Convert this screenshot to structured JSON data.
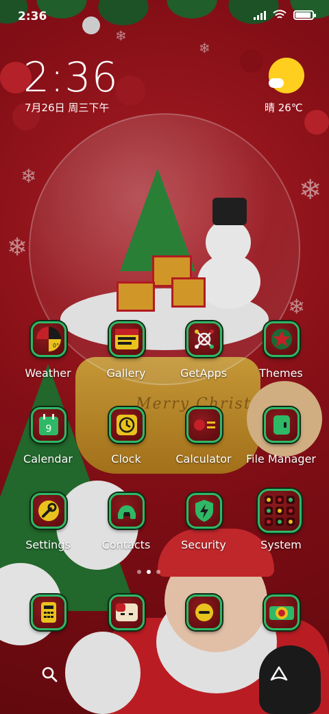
{
  "status_bar": {
    "time": "2:36",
    "icons": [
      "signal-icon",
      "wifi-icon",
      "battery-icon"
    ],
    "battery_level": 0.9
  },
  "clock_widget": {
    "time": "2:36",
    "date": "7月26日 周三下午"
  },
  "weather_widget": {
    "icon": "sunny-partly-cloudy-icon",
    "text": "晴 26℃"
  },
  "apps": {
    "row1": [
      {
        "label": "Weather",
        "icon": "weather-icon"
      },
      {
        "label": "Gallery",
        "icon": "gallery-icon"
      },
      {
        "label": "GetApps",
        "icon": "getapps-icon"
      },
      {
        "label": "Themes",
        "icon": "themes-icon"
      }
    ],
    "row2": [
      {
        "label": "Calendar",
        "icon": "calendar-icon",
        "badge": "9"
      },
      {
        "label": "Clock",
        "icon": "clock-icon"
      },
      {
        "label": "Calculator",
        "icon": "calculator-icon"
      },
      {
        "label": "File Manager",
        "icon": "file-manager-icon"
      }
    ],
    "row3": [
      {
        "label": "Settings",
        "icon": "settings-icon"
      },
      {
        "label": "Contacts",
        "icon": "contacts-icon"
      },
      {
        "label": "Security",
        "icon": "security-icon"
      },
      {
        "label": "System",
        "icon": "folder-icon"
      }
    ]
  },
  "dock": [
    {
      "icon": "phone-icon"
    },
    {
      "icon": "messages-icon"
    },
    {
      "icon": "browser-icon"
    },
    {
      "icon": "camera-icon"
    }
  ],
  "weather_icon_text": "0°",
  "wallpaper_text": "Merry Christ",
  "page_indicator": {
    "pages": 3,
    "active": 1
  },
  "bottom_bar": [
    "search-icon",
    "assistant-icon"
  ],
  "colors": {
    "tile_border": "#2fb865",
    "tile_fill": "#6e1015",
    "wallpaper": "#8e1018"
  }
}
